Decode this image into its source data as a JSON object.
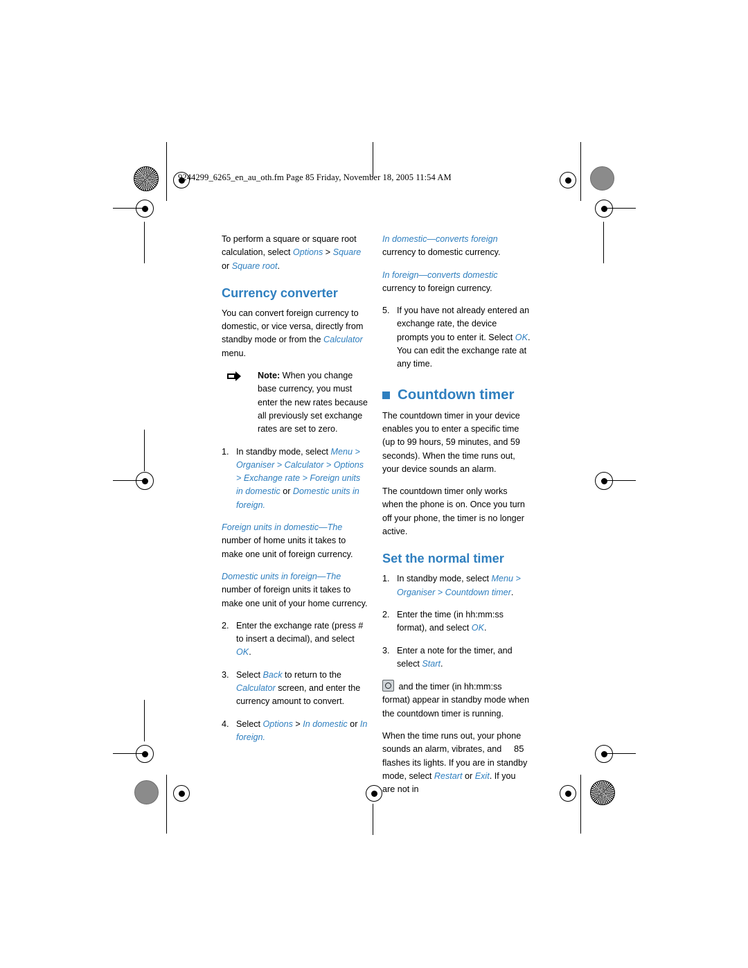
{
  "header": {
    "file_line": "9244299_6265_en_au_oth.fm  Page 85  Friday, November 18, 2005  11:54 AM"
  },
  "page_number": "85",
  "colors": {
    "accent": "#2f7fbf",
    "text": "#000000",
    "page_bg": "#ffffff"
  },
  "left_column": {
    "intro": {
      "part1": "To perform a square or square root calculation, select ",
      "options": "Options",
      "gt1": " > ",
      "square": "Square",
      "or": " or ",
      "square_root": "Square root",
      "period": "."
    },
    "currency_heading": "Currency converter",
    "currency_intro": {
      "part1": "You can convert foreign currency to domestic, or vice versa, directly from standby mode or from the ",
      "calculator": "Calculator",
      "part2": " menu."
    },
    "note": {
      "label": "Note:",
      "text": " When you change base currency, you must enter the new rates because all previously set exchange rates are set to zero."
    },
    "steps": [
      {
        "num": "1.",
        "text_before": "In standby mode, select ",
        "path": "Menu > Organiser > Calculator > Options > Exchange rate > Foreign units in domestic",
        "mid": " or ",
        "path2": "Domestic units in foreign",
        "period": "."
      },
      {
        "num": "2.",
        "text_before": "Enter the exchange rate (press # to insert a decimal), and select ",
        "link": "OK",
        "period": "."
      },
      {
        "num": "3.",
        "text_before": "Select ",
        "link": "Back",
        "mid": " to return to the ",
        "link2": "Calculator",
        "text_after": " screen, and enter the currency amount to convert."
      },
      {
        "num": "4.",
        "text_before": "Select ",
        "link": "Options",
        "gt": " > ",
        "link2": "In domestic",
        "mid": " or ",
        "link3": "In foreign",
        "period": "."
      }
    ],
    "definitions": [
      {
        "term": "Foreign units in domestic",
        "dash": "—The",
        "body": " number of home units it takes to make one unit of foreign currency."
      },
      {
        "term": "Domestic units in foreign",
        "dash": "—The",
        "body": " number of foreign units it takes to make one unit of your home currency."
      }
    ]
  },
  "right_column": {
    "definitions": [
      {
        "term": "In domestic",
        "dash": "—converts foreign",
        "body": " currency to domestic currency."
      },
      {
        "term": "In foreign",
        "dash": "—converts domestic",
        "body": " currency to foreign currency."
      }
    ],
    "step5": {
      "num": "5.",
      "text_before": "If you have not already entered an exchange rate, the device prompts you to enter it. Select ",
      "link": "OK",
      "text_after": ". You can edit the exchange rate at any time."
    },
    "countdown_heading": "Countdown timer",
    "countdown_para1": "The countdown timer in your device enables you to enter a specific time (up to 99 hours, 59 minutes, and 59 seconds). When the time runs out, your device sounds an alarm.",
    "countdown_para2": "The countdown timer only works when the phone is on. Once you turn off your phone, the timer is no longer active.",
    "normal_timer_heading": "Set the normal timer",
    "steps": [
      {
        "num": "1.",
        "text_before": "In standby mode, select ",
        "path": "Menu > Organiser > Countdown timer",
        "period": "."
      },
      {
        "num": "2.",
        "text_before": "Enter the time (in hh:mm:ss format), and select ",
        "link": "OK",
        "period": "."
      },
      {
        "num": "3.",
        "text_before": "Enter a note for the timer, and select ",
        "link": "Start",
        "period": "."
      }
    ],
    "glyph_para": {
      "icon_name": "countdown-timer-glyph",
      "text": " and the timer (in hh:mm:ss format) appear in standby mode when the countdown timer is running."
    },
    "final_para": {
      "part1": "When the time runs out, your phone sounds an alarm, vibrates, and flashes its lights. If you are in standby mode, select ",
      "link1": "Restart",
      "mid": " or ",
      "link2": "Exit",
      "part2": ". If you are not in"
    }
  }
}
